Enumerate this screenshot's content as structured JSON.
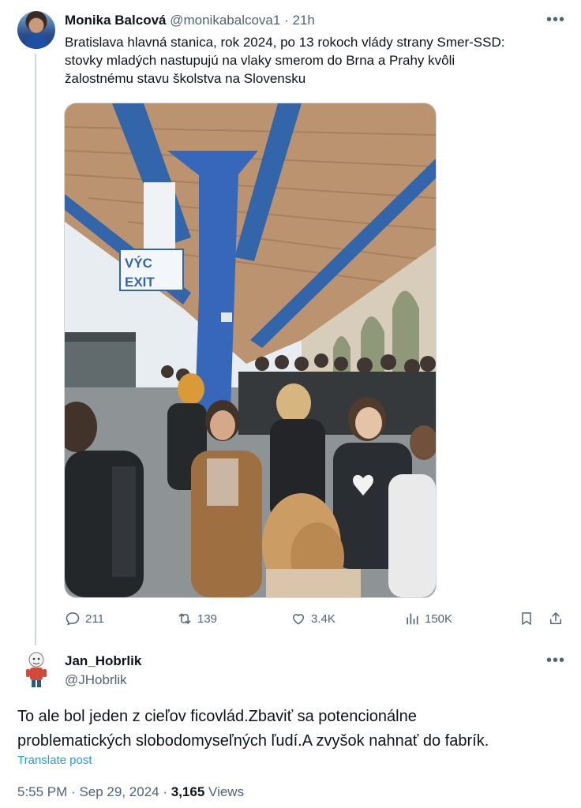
{
  "tweet": {
    "author_name": "Monika Balcová",
    "author_handle": "@monikabalcova1",
    "separator": "·",
    "time": "21h",
    "more_icon": "•••",
    "text_line1": "Bratislava hlavná stanica, rok 2024, po 13 rokoch vlády strany Smer-SSD:",
    "text_line2": "stovky mladých nastupujú na vlaky smerom do Brna a Prahy kvôli",
    "text_line3": "žalostnému stavu školstva na Slovensku",
    "photo_sign_top": "VÝC",
    "photo_sign_bottom": "EXIT",
    "actions": {
      "replies": "211",
      "reposts": "139",
      "likes": "3.4K",
      "views": "150K"
    }
  },
  "reply": {
    "author_name": "Jan_Hobrlik",
    "author_handle": "@JHobrlik",
    "more_icon": "•••",
    "text_line1": "To ale bol jeden z cieľov ficovlád.Zbaviť sa potencionálne",
    "text_line2": "problematických slobodomyseľných ľudí.A zvyšok nahnať do fabrík.",
    "translate_label": "Translate post",
    "time": "5:55 PM",
    "separator": "·",
    "date": "Sep 29, 2024",
    "separator2": "·",
    "views_count": "3,165",
    "views_label": "Views"
  },
  "colors": {
    "text": "#0f1419",
    "muted": "#536471",
    "link": "#1d9bf0",
    "divider": "#cfd9de"
  },
  "icons": [
    "more-icon",
    "reply-icon",
    "repost-icon",
    "like-icon",
    "views-icon",
    "bookmark-icon",
    "share-icon"
  ]
}
